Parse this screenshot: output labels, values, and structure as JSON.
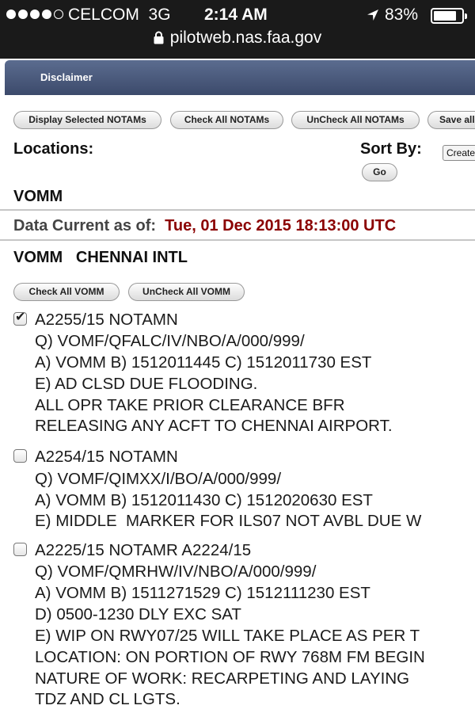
{
  "status_bar": {
    "carrier": "CELCOM",
    "network": "3G",
    "time": "2:14 AM",
    "battery": "83%",
    "battery_level": 0.83,
    "signal_bars_filled": 4,
    "signal_bars_total": 5
  },
  "browser": {
    "url": "pilotweb.nas.faa.gov"
  },
  "banner": {
    "disclaimer": "Disclaimer"
  },
  "toolbar": {
    "display_selected": "Display Selected NOTAMs",
    "check_all": "Check All NOTAMs",
    "uncheck_all": "UnCheck All NOTAMs",
    "save_all": "Save all"
  },
  "locations": {
    "label": "Locations:",
    "value": "VOMM"
  },
  "sort": {
    "label": "Sort By:",
    "selected": "Create",
    "go": "Go"
  },
  "data_current": {
    "label": "Data Current as of:",
    "value": "Tue, 01 Dec 2015 18:13:00 UTC"
  },
  "airport": {
    "code": "VOMM",
    "name": "CHENNAI INTL"
  },
  "airport_buttons": {
    "check": "Check All  VOMM",
    "uncheck": "UnCheck All VOMM"
  },
  "notams": [
    {
      "checked": true,
      "lines": [
        "A2255/15 NOTAMN",
        "Q) VOMF/QFALC/IV/NBO/A/000/999/",
        "A) VOMM B) 1512011445 C) 1512011730 EST",
        "E) AD CLSD DUE FLOODING.",
        "ALL OPR TAKE PRIOR CLEARANCE BFR",
        "RELEASING ANY ACFT TO CHENNAI AIRPORT."
      ]
    },
    {
      "checked": false,
      "lines": [
        "A2254/15 NOTAMN",
        "Q) VOMF/QIMXX/I/BO/A/000/999/",
        "A) VOMM B) 1512011430 C) 1512020630 EST",
        "E) MIDDLE  MARKER FOR ILS07 NOT AVBL DUE W"
      ]
    },
    {
      "checked": false,
      "lines": [
        "A2225/15 NOTAMR A2224/15",
        "Q) VOMF/QMRHW/IV/NBO/A/000/999/",
        "A) VOMM B) 1511271529 C) 1512111230 EST",
        "D) 0500-1230 DLY EXC SAT",
        "E) WIP ON RWY07/25 WILL TAKE PLACE AS PER T",
        "LOCATION: ON PORTION OF RWY 768M FM BEGIN",
        "NATURE OF WORK: RECARPETING AND LAYING",
        "TDZ AND CL LGTS."
      ]
    }
  ]
}
